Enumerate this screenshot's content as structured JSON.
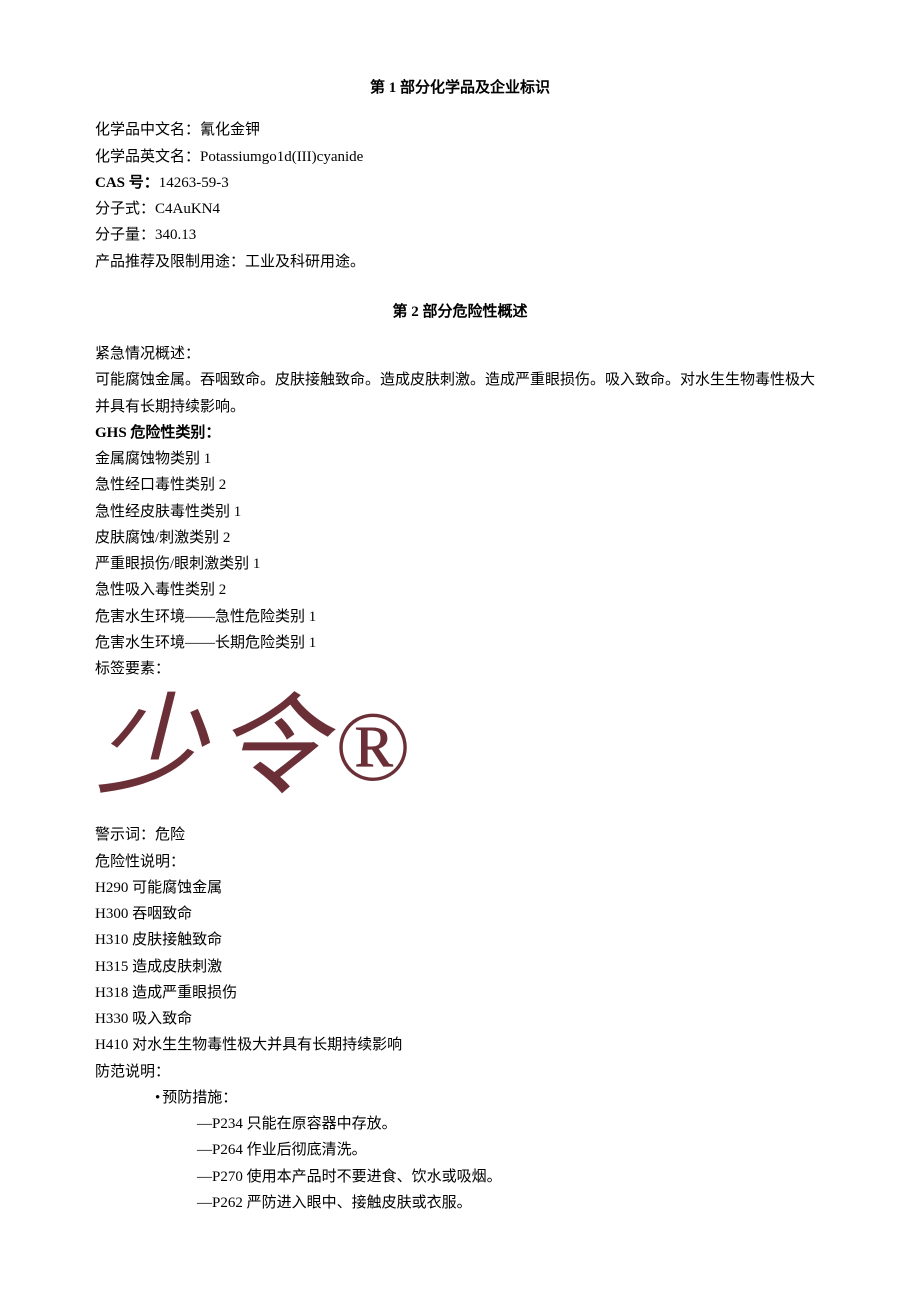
{
  "section1": {
    "title_prefix": "第 ",
    "title_num": "1",
    "title_suffix": " 部分化学品及企业标识",
    "name_cn_label": "化学品中文名：",
    "name_cn_value": "氰化金钾",
    "name_en_label": "化学品英文名：",
    "name_en_value": "Potassiumgo1d(III)cyanide",
    "cas_label": "CAS 号：",
    "cas_value": "14263-59-3",
    "formula_label": "分子式：",
    "formula_value": "C4AuKN4",
    "mw_label": "分子量：",
    "mw_value": "340.13",
    "use_label": "产品推荐及限制用途：",
    "use_value": "工业及科研用途。"
  },
  "section2": {
    "title_prefix": "第 ",
    "title_num": "2",
    "title_suffix": " 部分危险性概述",
    "emergency_label": "紧急情况概述：",
    "emergency_text": "可能腐蚀金属。吞咽致命。皮肤接触致命。造成皮肤刺激。造成严重眼损伤。吸入致命。对水生生物毒性极大并具有长期持续影响。",
    "ghs_label": "GHS 危险性类别：",
    "ghs_list": [
      "金属腐蚀物类别 1",
      "急性经口毒性类别 2",
      "急性经皮肤毒性类别 1",
      "皮肤腐蚀/刺激类别 2",
      "严重眼损伤/眼刺激类别 1",
      "急性吸入毒性类别 2",
      "危害水生环境——急性危险类别 1",
      "危害水生环境——长期危险类别 1"
    ],
    "label_elements": "标签要素：",
    "watermark": {
      "c1": "少",
      "c2": "令",
      "reg": "®"
    },
    "signal_label": "警示词：",
    "signal_value": "危险",
    "hazard_label": "危险性说明：",
    "hazard_list": [
      "H290 可能腐蚀金属",
      "H300 吞咽致命",
      "H310 皮肤接触致命",
      "H315 造成皮肤刺激",
      "H318 造成严重眼损伤",
      "H330 吸入致命",
      "H410 对水生生物毒性极大并具有长期持续影响"
    ],
    "precaution_label": "防范说明：",
    "prevention_heading": "预防措施：",
    "prevention_list": [
      "P234 只能在原容器中存放。",
      "P264 作业后彻底清洗。",
      "P270 使用本产品时不要进食、饮水或吸烟。",
      "P262 严防进入眼中、接触皮肤或衣服。"
    ]
  }
}
